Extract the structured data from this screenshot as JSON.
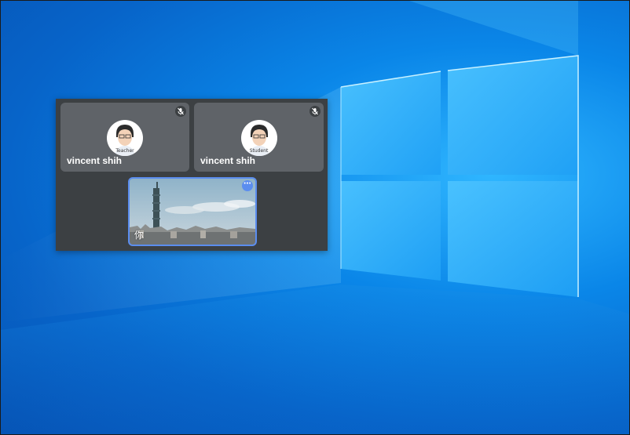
{
  "colors": {
    "panel_bg": "#3c4043",
    "tile_bg": "#5f6368",
    "active_border": "#5b8def",
    "desktop_blue": "#0a86e8"
  },
  "meeting": {
    "participants": [
      {
        "name": "vincent shih",
        "avatar_caption": "Teacher",
        "muted": true,
        "icon": "mic-off-icon"
      },
      {
        "name": "vincent shih",
        "avatar_caption": "Student",
        "muted": true,
        "icon": "mic-off-icon"
      }
    ],
    "self_tile": {
      "label": "你",
      "menu_icon": "more-options-icon",
      "video": "city-skyline-with-tower"
    }
  },
  "desktop": {
    "wallpaper": "windows-10-logo"
  }
}
